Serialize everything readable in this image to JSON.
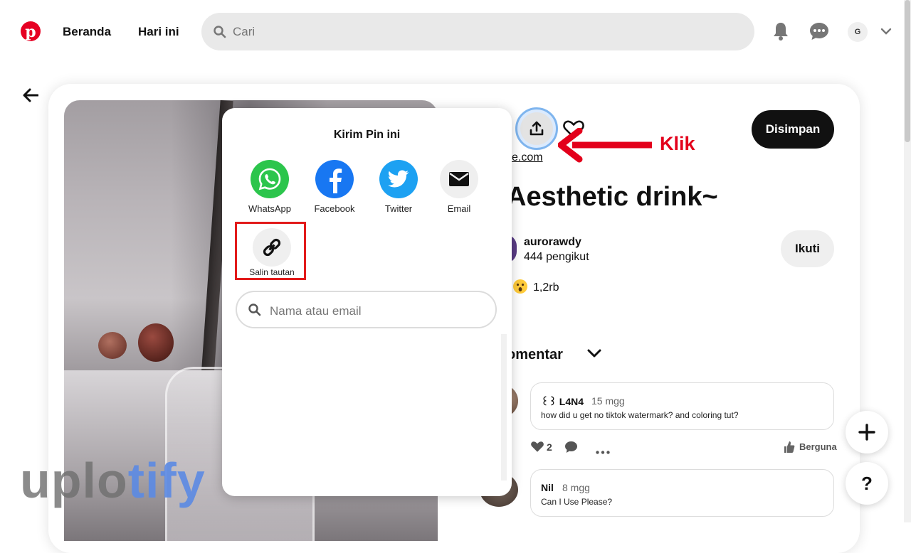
{
  "header": {
    "nav_home": "Beranda",
    "nav_today": "Hari ini",
    "search_placeholder": "Cari",
    "avatar_initial": "G"
  },
  "share_popup": {
    "title": "Kirim Pin ini",
    "options": [
      {
        "label": "WhatsApp",
        "icon": "whatsapp-icon",
        "color": "#2cc54c"
      },
      {
        "label": "Facebook",
        "icon": "facebook-icon",
        "color": "#1877f2"
      },
      {
        "label": "Twitter",
        "icon": "twitter-icon",
        "color": "#1da1f2"
      },
      {
        "label": "Email",
        "icon": "email-icon",
        "color": "#efefef"
      }
    ],
    "copy_link_label": "Salin tautan",
    "search_placeholder": "Nama atau email"
  },
  "pin": {
    "save_label": "Disimpan",
    "link_text": "e.com",
    "title": "Aesthetic drink~",
    "author": {
      "name": "aurorawdy",
      "followers": "444 pengikut"
    },
    "follow_label": "Ikuti",
    "reaction_count": "1,2rb",
    "comments_heading": "omentar"
  },
  "annotation": {
    "label": "Klik",
    "color": "#e3001b"
  },
  "comments": [
    {
      "user": "꒰꒱ L4N4",
      "time": "15 mgg",
      "text": "how did u get no tiktok watermark? and coloring tut?"
    },
    {
      "user": "Nil",
      "time": "8 mgg",
      "text": "Can I Use Please?"
    }
  ],
  "comment_actions": {
    "like_count": "2",
    "helpful_label": "Berguna"
  },
  "fab": {
    "help_label": "?"
  },
  "watermark": {
    "part1": "uplo",
    "part2": "tify"
  },
  "colors": {
    "brand": "#e60023",
    "save_button": "#111111",
    "highlight_box": "#e21b1b"
  }
}
